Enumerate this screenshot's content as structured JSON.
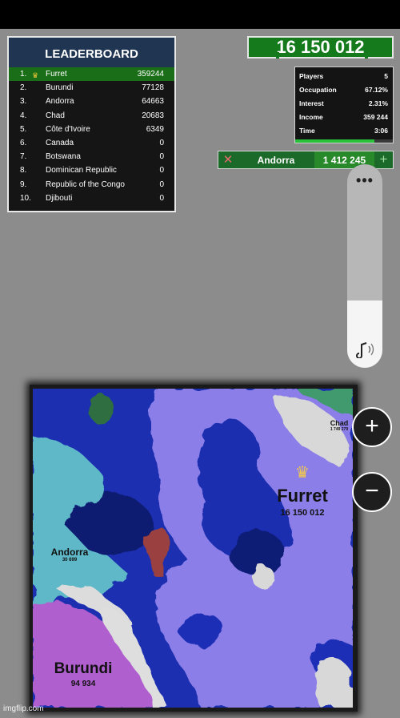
{
  "leaderboard": {
    "title": "LEADERBOARD",
    "rows": [
      {
        "rank": "1.",
        "name": "Furret",
        "score": "359244"
      },
      {
        "rank": "2.",
        "name": "Burundi",
        "score": "77128"
      },
      {
        "rank": "3.",
        "name": "Andorra",
        "score": "64663"
      },
      {
        "rank": "4.",
        "name": "Chad",
        "score": "20683"
      },
      {
        "rank": "5.",
        "name": "Côte d'Ivoire",
        "score": "6349"
      },
      {
        "rank": "6.",
        "name": "Canada",
        "score": "0"
      },
      {
        "rank": "7.",
        "name": "Botswana",
        "score": "0"
      },
      {
        "rank": "8.",
        "name": "Dominican Republic",
        "score": "0"
      },
      {
        "rank": "9.",
        "name": "Republic of the Congo",
        "score": "0"
      },
      {
        "rank": "10.",
        "name": "Djibouti",
        "score": "0"
      }
    ]
  },
  "total": "16 150 012",
  "stats": {
    "players_label": "Players",
    "players": "5",
    "occupation_label": "Occupation",
    "occupation": "67.12%",
    "interest_label": "Interest",
    "interest": "2.31%",
    "income_label": "Income",
    "income": "359 244",
    "time_label": "Time",
    "time": "3:06",
    "progress": 0.81
  },
  "attack": {
    "close_symbol": "✕",
    "target": "Andorra",
    "amount": "1 412 245",
    "plus_symbol": "+"
  },
  "volume": {
    "menu_symbol": "•••",
    "level": 0.33
  },
  "map": {
    "labels": {
      "chad": "Chad",
      "chad_troops": "1 749 279",
      "furret": "Furret",
      "furret_troops": "16 150 012",
      "andorra": "Andorra",
      "andorra_troops": "30 699",
      "burundi": "Burundi",
      "burundi_troops": "94 934"
    }
  },
  "zoom": {
    "in": "+",
    "out": "−"
  },
  "watermark": "imgflip.com",
  "colors": {
    "furret": "#8b7ee8",
    "ocean": "#1a2fb5",
    "andorra": "#5fb8c8",
    "burundi": "#b05fcf",
    "chad": "#3f9a6d",
    "enemy": "#9a3f3f",
    "leader_row": "#1b6e18"
  }
}
